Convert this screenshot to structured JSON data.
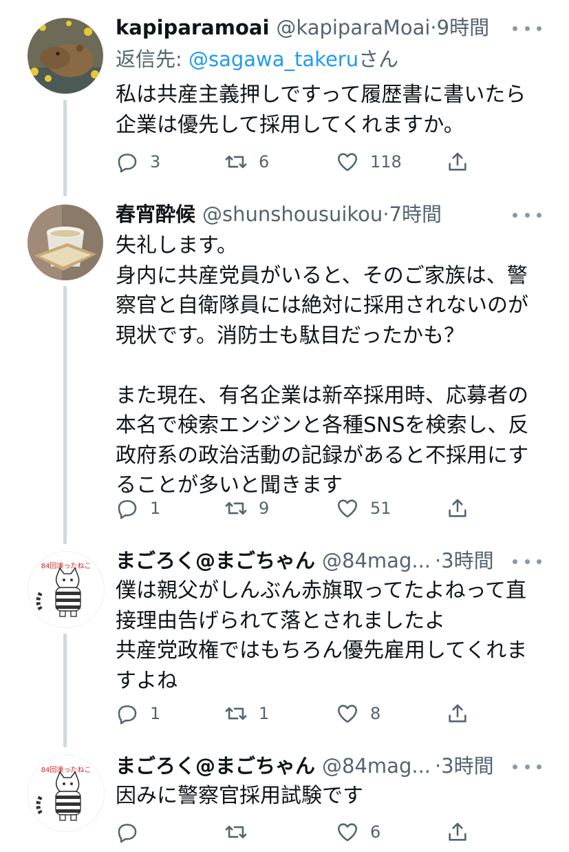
{
  "tweets": [
    {
      "name": "kapiparamoai",
      "handle": "@kapiparaMoai",
      "time": "·9時間",
      "reply_prefix": "返信先: ",
      "reply_mention": "@sagawa_takeru",
      "reply_suffix": "さん",
      "text": "私は共産主義押しですって履歴書に書いたら\n企業は優先して採用してくれますか。",
      "replies": "3",
      "retweets": "6",
      "likes": "118"
    },
    {
      "name": "春宵酔候",
      "handle": "@shunshousuikou",
      "time": "·7時間",
      "text": "失礼します。\n身内に共産党員がいると、そのご家族は、警\n察官と自衛隊員には絶対に採用されないのが\n現状です。消防士も駄目だったかも？\n\nまた現在、有名企業は新卒採用時、応募者の\n本名で検索エンジンと各種SNSを検索し、反\n政府系の政治活動の記録があると不採用にす\nることが多いと聞きます",
      "replies": "1",
      "retweets": "9",
      "likes": "51"
    },
    {
      "name": "まごろく@まごちゃん",
      "handle": "@84mag...",
      "time": "·3時間",
      "avatar_text": "84回凍ったねこ",
      "text": "僕は親父がしんぶん赤旗取ってたよねって直\n接理由告げられて落とされましたよ\n共産党政権ではもちろん優先雇用してくれま\nすよね",
      "replies": "1",
      "retweets": "1",
      "likes": "8"
    },
    {
      "name": "まごろく@まごちゃん",
      "handle": "@84mag...",
      "time": "·3時間",
      "avatar_text": "84回凍ったねこ",
      "text": "因みに警察官採用試験です",
      "replies": "",
      "retweets": "",
      "likes": "6"
    }
  ],
  "icons": {
    "reply": "reply-icon",
    "retweet": "retweet-icon",
    "like": "heart-icon",
    "share": "share-icon",
    "more": "more-options-icon"
  },
  "colors": {
    "text": "#0f1419",
    "secondary": "#536471",
    "link": "#1d9bf0",
    "thread_line": "#cfd9de"
  }
}
